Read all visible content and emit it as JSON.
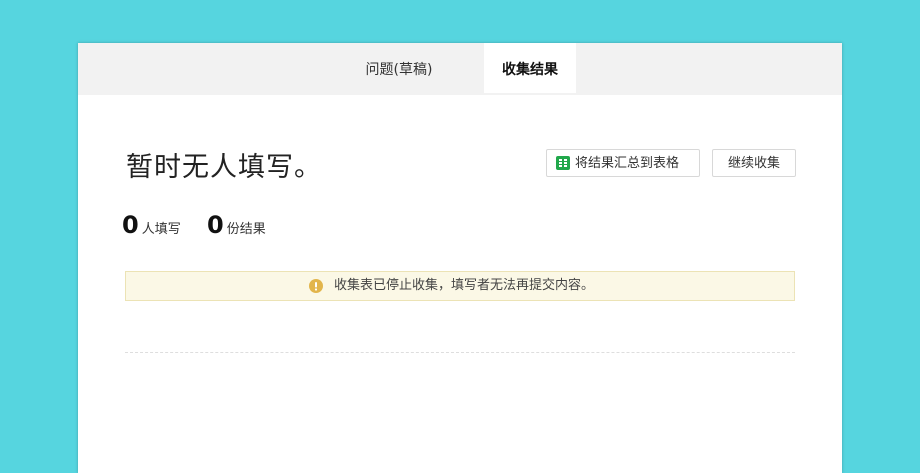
{
  "tabs": {
    "draft_label": "问题(草稿)",
    "results_label": "收集结果"
  },
  "main": {
    "title": "暂时无人填写。",
    "export_button": "将结果汇总到表格",
    "continue_button": "继续收集",
    "stats": {
      "filled_count": "0",
      "filled_label": "人填写",
      "result_count": "0",
      "result_label": "份结果"
    },
    "notice": "收集表已停止收集，填写者无法再提交内容。"
  },
  "colors": {
    "background": "#56d5df",
    "sheet_icon": "#21a84b",
    "warning_icon": "#e2b54c"
  },
  "icons": {
    "export": "spreadsheet-icon",
    "notice": "warning-icon"
  }
}
